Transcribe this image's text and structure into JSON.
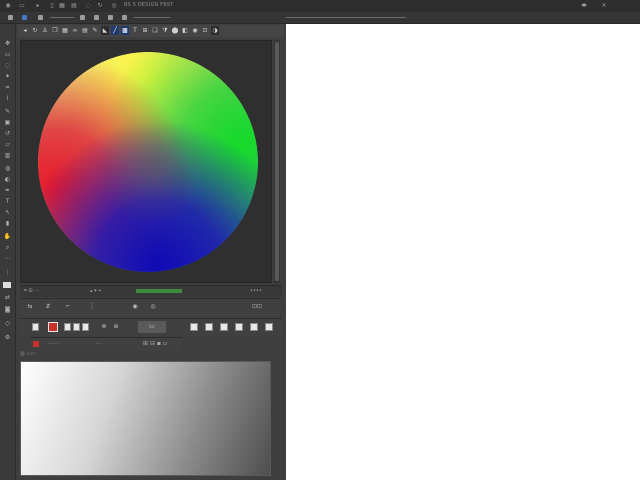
{
  "app": {
    "menubar": {
      "file_label": "BS 5 DESIGN FRST"
    },
    "window_controls": {
      "close_glyph": "✕"
    }
  },
  "colors": {
    "panel_bg": "#3e3e3e",
    "canvas_bg": "#ffffff",
    "wheel_top": "#f4f24c",
    "wheel_right": "#1ed82f",
    "wheel_left": "#e0222c",
    "wheel_bottom": "#1a10b8",
    "progress_green": "#3d8a3d",
    "accent_red": "#c8302a"
  },
  "status": {
    "left_text": "⌗ ⊞ ⋯",
    "mid_text": "▴ ▾ ⌖",
    "right_text": "••••"
  },
  "controls": {
    "row1_right_label": "⊡⊡",
    "row3_text": "⊞ ⊟ ▪ ▫",
    "swatch_label": "⊗"
  },
  "gradient_panel": {
    "label": "▥ ▭▭"
  }
}
